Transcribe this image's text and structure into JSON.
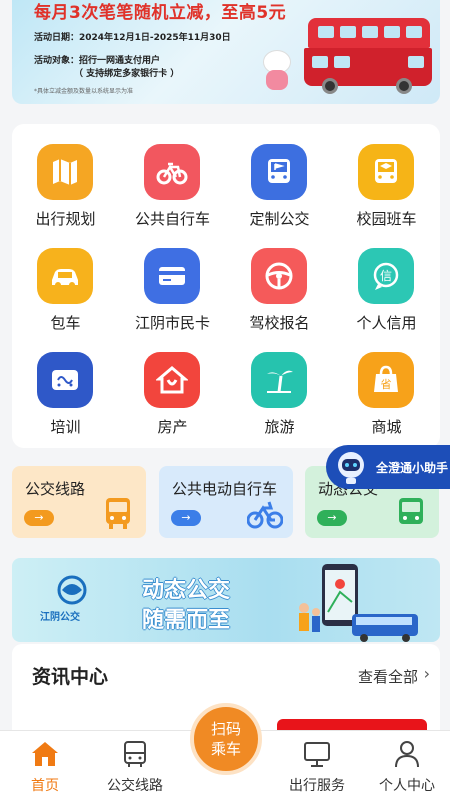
{
  "banner": {
    "headline": "每月3次笔笔随机立减，至高5元",
    "date_line": "活动日期：2024年12月1日-2025年11月30日",
    "target_line": "活动对象：招行一网通支付用户",
    "target_note": "（ 支持绑定多家银行卡 ）",
    "fine_print": "*具体立减金额及数量以系统显示为准"
  },
  "services": [
    {
      "label": "出行规划",
      "icon": "map-icon",
      "color": "#f5a623"
    },
    {
      "label": "公共自行车",
      "icon": "bicycle-icon",
      "color": "#f2575f"
    },
    {
      "label": "定制公交",
      "icon": "bus-flag-icon",
      "color": "#3d6fe0"
    },
    {
      "label": "校园班车",
      "icon": "school-bus-icon",
      "color": "#f6b417"
    },
    {
      "label": "包车",
      "icon": "car-icon",
      "color": "#f7b21c"
    },
    {
      "label": "江阴市民卡",
      "icon": "card-icon",
      "color": "#3f6fe3"
    },
    {
      "label": "驾校报名",
      "icon": "steering-wheel-icon",
      "color": "#f55a5a"
    },
    {
      "label": "个人信用",
      "icon": "credit-icon",
      "color": "#2cc7b4"
    },
    {
      "label": "培训",
      "icon": "training-icon",
      "color": "#2f58c8"
    },
    {
      "label": "房产",
      "icon": "house-icon",
      "color": "#f2453d"
    },
    {
      "label": "旅游",
      "icon": "palm-tree-icon",
      "color": "#26c3ae"
    },
    {
      "label": "商城",
      "icon": "shopping-bag-icon",
      "color": "#f7a21a"
    }
  ],
  "quick": [
    {
      "label": "公交线路",
      "icon": "bus-icon"
    },
    {
      "label": "公共电动自行车",
      "icon": "ebike-icon"
    },
    {
      "label": "动态公交",
      "icon": "realtime-bus-icon"
    }
  ],
  "assistant": {
    "label": "全澄通小助手"
  },
  "promo": {
    "logo_text": "江阴公交",
    "slogan1": "动态公交",
    "slogan2": "随需而至"
  },
  "news": {
    "title": "资讯中心",
    "more": "查看全部"
  },
  "scan": {
    "line1": "扫码",
    "line2": "乘车"
  },
  "tabs": [
    {
      "label": "首页",
      "icon": "home-icon",
      "active": true
    },
    {
      "label": "公交线路",
      "icon": "bus-icon",
      "active": false
    },
    {
      "label": "出行服务",
      "icon": "monitor-icon",
      "active": false
    },
    {
      "label": "个人中心",
      "icon": "person-icon",
      "active": false
    }
  ],
  "colors": {
    "accent": "#f07a13"
  }
}
